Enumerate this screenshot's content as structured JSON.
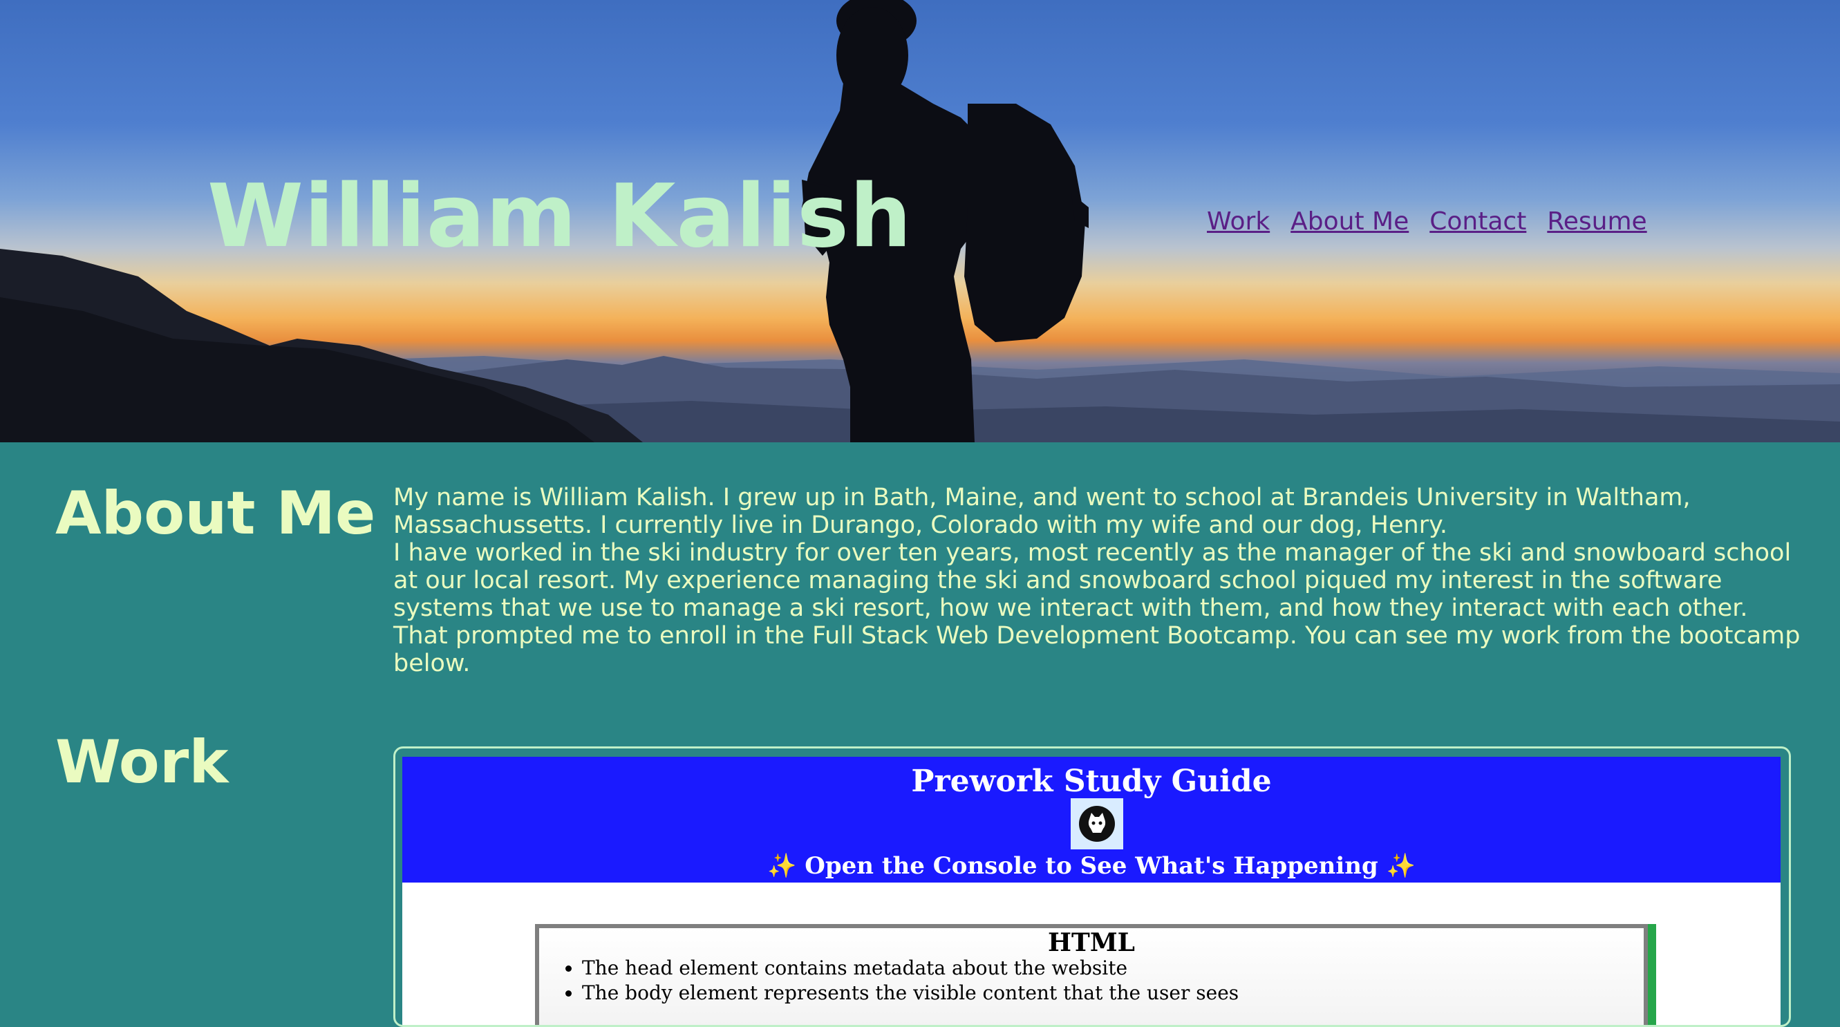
{
  "header": {
    "title": "William Kalish",
    "nav": [
      {
        "label": "Work"
      },
      {
        "label": "About Me"
      },
      {
        "label": "Contact"
      },
      {
        "label": "Resume"
      }
    ]
  },
  "about": {
    "heading": "About Me",
    "paragraphs": [
      "My name is William Kalish. I grew up in Bath, Maine, and went to school at Brandeis University in Waltham, Massachussetts. I currently live in Durango, Colorado with my wife and our dog, Henry.",
      "I have worked in the ski industry for over ten years, most recently as the manager of the ski and snowboard school at our local resort. My experience managing the ski and snowboard school piqued my interest in the software systems that we use to manage a ski resort, how we interact with them, and how they interact with each other. That prompted me to enroll in the Full Stack Web Development Bootcamp. You can see my work from the bootcamp below."
    ]
  },
  "work": {
    "heading": "Work",
    "projects": [
      {
        "title": "Prework Study Guide",
        "subtitle": "✨ Open the Console to See What's Happening ✨",
        "section_title": "HTML",
        "bullets": [
          "The head element contains metadata about the website",
          "The body element represents the visible content that the user sees"
        ]
      }
    ]
  },
  "colors": {
    "page_background": "#2a8585",
    "title_color": "#bff0c8",
    "body_text": "#eafbc0",
    "nav_link": "#5a1f86",
    "card_header": "#1a1aff"
  }
}
